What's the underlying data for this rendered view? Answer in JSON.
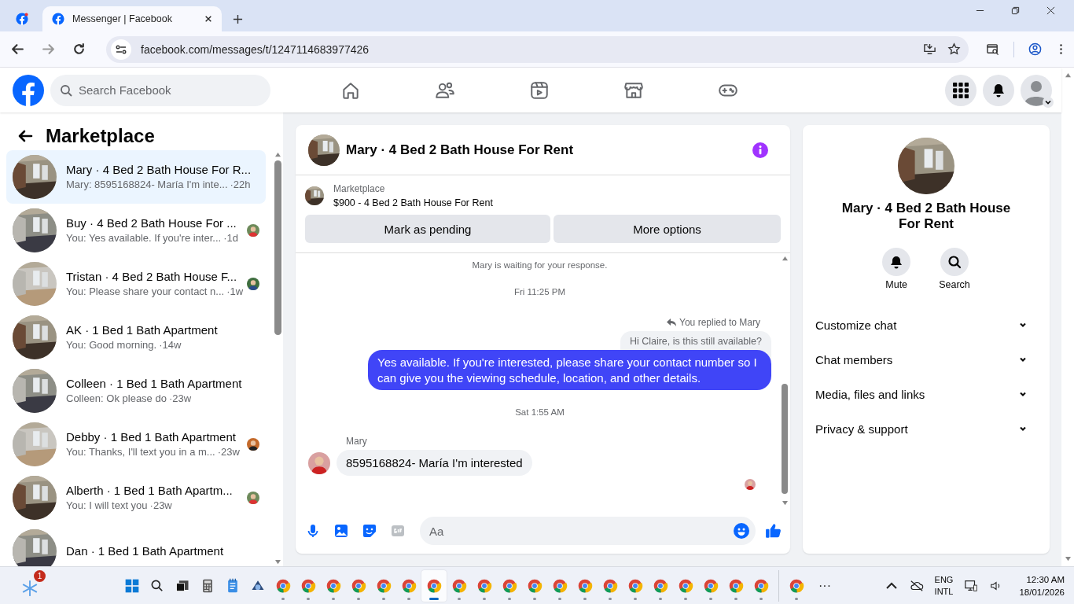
{
  "browser": {
    "tabs": [
      {
        "kind": "pinned",
        "selected": false
      },
      {
        "kind": "page",
        "title": "Messenger | Facebook",
        "selected": true
      }
    ],
    "url": "facebook.com/messages/t/1247114683977426"
  },
  "header": {
    "search_placeholder": "Search Facebook",
    "nav": [
      {
        "kind": "home"
      },
      {
        "kind": "friends"
      },
      {
        "kind": "video"
      },
      {
        "kind": "marketplace"
      },
      {
        "kind": "gaming"
      }
    ]
  },
  "sidebar": {
    "title": "Marketplace",
    "conversations": [
      {
        "title": "Mary · 4 Bed 2 Bath House For R...",
        "preview": "Mary: 8595168824- María I'm inte...",
        "time": "·22h",
        "selected": true,
        "seen_avatar": false
      },
      {
        "title": "Buy · 4 Bed 2 Bath House For ...",
        "preview": "You: Yes available. If you're inter...",
        "time": "·1d",
        "selected": false,
        "seen_avatar": true
      },
      {
        "title": "Tristan · 4 Bed 2 Bath House F...",
        "preview": "You: Please share your contact n...",
        "time": "·1w",
        "selected": false,
        "seen_avatar": true
      },
      {
        "title": "AK · 1 Bed 1 Bath Apartment",
        "preview": "You: Good morning.",
        "time": "·14w",
        "selected": false,
        "seen_avatar": false
      },
      {
        "title": "Colleen · 1 Bed 1 Bath Apartment",
        "preview": "Colleen: Ok please do",
        "time": "·23w",
        "selected": false,
        "seen_avatar": false
      },
      {
        "title": "Debby · 1 Bed 1 Bath Apartment",
        "preview": "You: Thanks, I'll text you in a m...",
        "time": "·23w",
        "selected": false,
        "seen_avatar": true
      },
      {
        "title": "Alberth · 1 Bed 1 Bath Apartm...",
        "preview": "You: I will text you",
        "time": "·23w",
        "selected": false,
        "seen_avatar": true
      },
      {
        "title": "Dan · 1 Bed 1 Bath Apartment",
        "selected": false,
        "seen_avatar": false
      }
    ]
  },
  "chat": {
    "title": "Mary · 4 Bed 2 Bath House For Rent",
    "listing": {
      "label": "Marketplace",
      "title": "$900 - 4 Bed 2 Bath House For Rent"
    },
    "actions": [
      "Mark as pending",
      "More options"
    ],
    "messages": [
      {
        "kind": "notice",
        "text": "Mary is waiting for your response."
      },
      {
        "kind": "timestamp",
        "text": "Fri 11:25 PM"
      },
      {
        "kind": "reply_label",
        "text": "You replied to Mary"
      },
      {
        "kind": "quoted",
        "text": "Hi Claire, is this still available?"
      },
      {
        "kind": "outgoing",
        "text": "Yes available. If you're interested, please share your contact number so I can give you the viewing schedule, location, and other details."
      },
      {
        "kind": "timestamp",
        "text": "Sat 1:55 AM"
      },
      {
        "kind": "sender",
        "text": "Mary"
      },
      {
        "kind": "incoming",
        "text": "8595168824- María I'm interested"
      },
      {
        "kind": "seen"
      }
    ],
    "composer": {
      "placeholder": "Aa"
    }
  },
  "details": {
    "title": "Mary · 4 Bed 2 Bath House For Rent",
    "actions": [
      {
        "kind": "mute",
        "label": "Mute"
      },
      {
        "kind": "search",
        "label": "Search"
      }
    ],
    "sections": [
      {
        "label": "Customize chat",
        "expanded": false
      },
      {
        "label": "Chat members",
        "expanded": false
      },
      {
        "label": "Media, files and links",
        "expanded": false
      },
      {
        "label": "Privacy & support",
        "expanded": false
      }
    ]
  },
  "taskbar": {
    "weather_badge": "1",
    "apps": [
      {
        "kind": "start"
      },
      {
        "kind": "search"
      },
      {
        "kind": "taskview"
      },
      {
        "kind": "calculator"
      },
      {
        "kind": "notepad"
      },
      {
        "kind": "app"
      },
      {
        "kind": "browser",
        "selected": false
      },
      {
        "kind": "browser",
        "selected": false
      },
      {
        "kind": "browser",
        "selected": false
      },
      {
        "kind": "browser",
        "selected": false
      },
      {
        "kind": "browser",
        "selected": false
      },
      {
        "kind": "browser",
        "selected": false
      },
      {
        "kind": "browser",
        "selected": true
      },
      {
        "kind": "browser",
        "selected": false
      },
      {
        "kind": "browser",
        "selected": false
      },
      {
        "kind": "browser",
        "selected": false
      },
      {
        "kind": "browser",
        "selected": false
      },
      {
        "kind": "browser",
        "selected": false
      },
      {
        "kind": "browser",
        "selected": false
      },
      {
        "kind": "browser",
        "selected": false
      },
      {
        "kind": "browser",
        "selected": false
      },
      {
        "kind": "browser",
        "selected": false
      },
      {
        "kind": "browser",
        "selected": false
      },
      {
        "kind": "browser",
        "selected": false
      },
      {
        "kind": "browser",
        "selected": false
      },
      {
        "kind": "browser",
        "selected": false
      },
      {
        "kind": "separator"
      },
      {
        "kind": "browser",
        "selected": false
      },
      {
        "kind": "more",
        "label": "···"
      }
    ],
    "language": [
      "ENG",
      "INTL"
    ],
    "time": "12:30 AM",
    "date": "18/01/2026"
  }
}
